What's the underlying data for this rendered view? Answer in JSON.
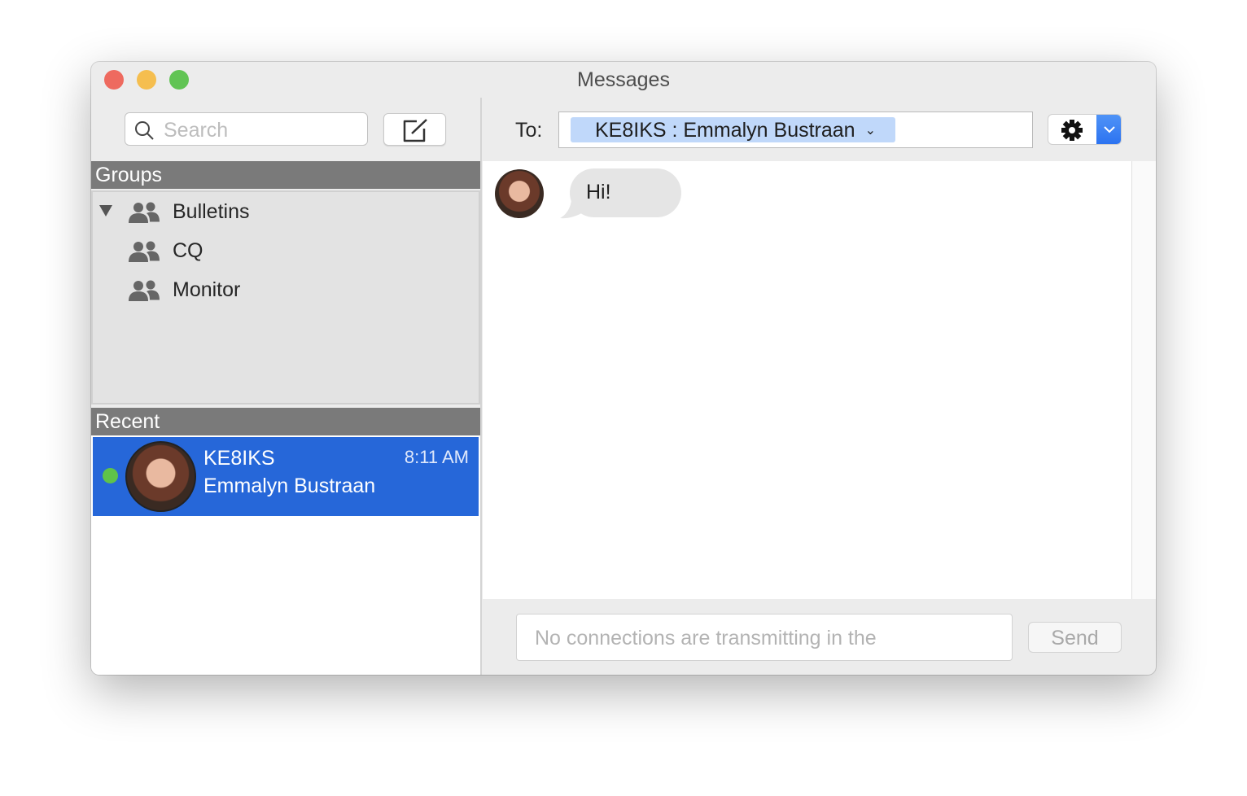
{
  "window": {
    "title": "Messages",
    "traffic_lights": {
      "close": "#ee6a5f",
      "minimize": "#f5be4f",
      "zoom": "#61c454"
    }
  },
  "sidebar": {
    "search": {
      "placeholder": "Search",
      "icon": "search-icon"
    },
    "compose_icon": "compose-icon",
    "groups": {
      "header": "Groups",
      "items": [
        {
          "label": "Bulletins",
          "expanded": true
        },
        {
          "label": "CQ"
        },
        {
          "label": "Monitor"
        }
      ]
    },
    "recent": {
      "header": "Recent",
      "items": [
        {
          "callsign": "KE8IKS",
          "name": "Emmalyn Bustraan",
          "time": "8:11 AM",
          "online": true,
          "selected": true
        }
      ]
    }
  },
  "conversation": {
    "to_label": "To:",
    "recipient": "KE8IKS : Emmalyn Bustraan",
    "messages": [
      {
        "text": "Hi!",
        "incoming": true
      }
    ],
    "input_placeholder": "No connections are transmitting in the",
    "send_label": "Send"
  },
  "colors": {
    "selection": "#2667d9",
    "token": "#c0d8fa",
    "accent": "#2f7bf5"
  }
}
